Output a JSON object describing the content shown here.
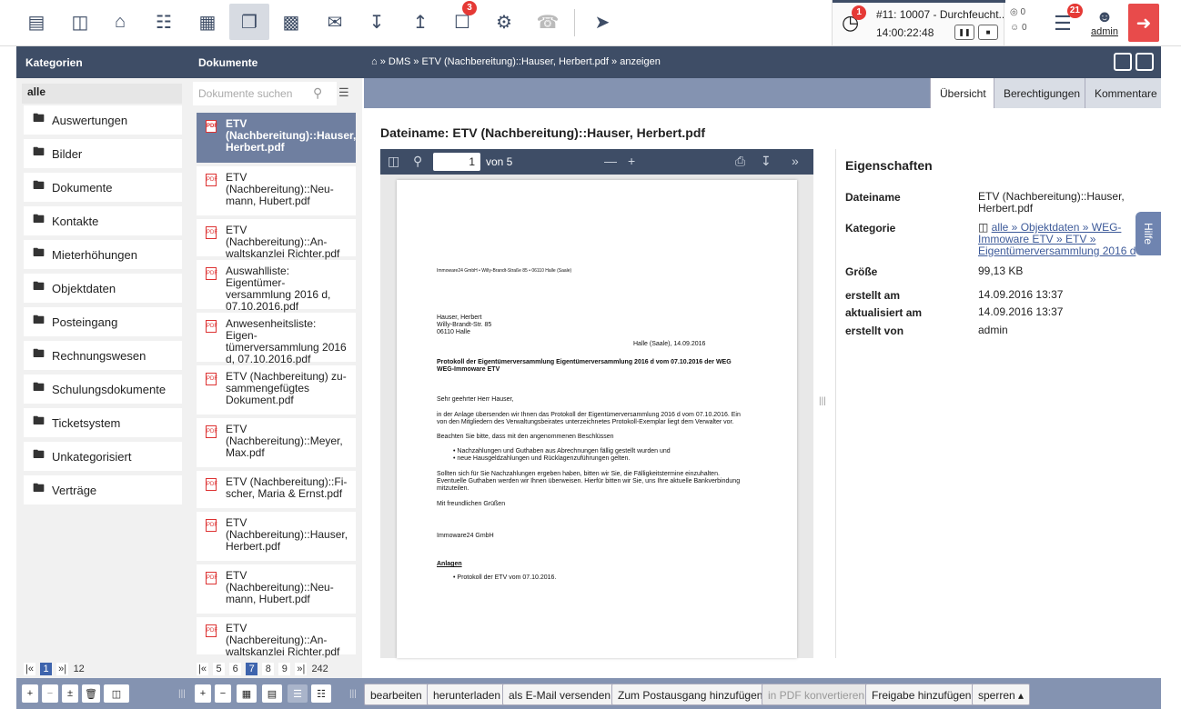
{
  "toolbar": {
    "dms_badge": "3",
    "timer": {
      "badge": "1",
      "task": "#11: 10007 - Durchfeucht...",
      "time": "14:00:22:48"
    },
    "counts": [
      "0",
      "0"
    ],
    "messages_badge": "21",
    "user": "admin"
  },
  "headers": {
    "categories": "Kategorien",
    "documents": "Dokumente",
    "breadcrumb": "⌂  »  DMS  »  ETV (Nachbereitung)::Hauser, Herbert.pdf  » anzeigen"
  },
  "categories": {
    "all": "alle",
    "items": [
      "Auswertungen",
      "Bilder",
      "Dokumente",
      "Kontakte",
      "Mieterhöhungen",
      "Objektdaten",
      "Posteingang",
      "Rechnungswesen",
      "Schulungsdokumente",
      "Ticketsystem",
      "Unkategorisiert",
      "Verträge"
    ]
  },
  "documents": {
    "search_placeholder": "Dokumente suchen",
    "items": [
      "ETV (Nachbereitung)::Hauser, Herbert.pdf",
      "ETV (Nachbereitung)::Neu-mann, Hubert.pdf",
      "ETV (Nachbereitung)::An-waltskanzlei Richter.pdf",
      "Auswahlliste: Eigentümer-versammlung 2016 d, 07.10.2016.pdf",
      "Anwesenheitsliste: Eigen-tümerversammlung 2016 d, 07.10.2016.pdf",
      "ETV (Nachbereitung) zu-sammengefügtes Dokument.pdf",
      "ETV (Nachbereitung)::Meyer, Max.pdf",
      "ETV (Nachbereitung)::Fi-scher, Maria & Ernst.pdf",
      "ETV (Nachbereitung)::Hauser, Herbert.pdf",
      "ETV (Nachbereitung)::Neu-mann, Hubert.pdf",
      "ETV (Nachbereitung)::An-waltskanzlei Richter.pdf"
    ]
  },
  "tabs": [
    "Übersicht",
    "Berechtigungen",
    "Kommentare"
  ],
  "file_title": "Dateiname: ETV (Nachbereitung)::Hauser, Herbert.pdf",
  "viewer": {
    "page": "1",
    "of": "von 5",
    "lines": [
      "Immoware24 GmbH • Willy-Brandt-Straße 85 • 06110 Halle (Saale)",
      "Hauser, Herbert",
      "Willy-Brandt-Str. 85",
      "06110 Halle",
      "Halle (Saale), 14.09.2016",
      "Protokoll der Eigentümerversammlung Eigentümerversammlung 2016 d vom 07.10.2016 der WEG",
      "WEG-Immoware ETV",
      "Sehr geehrter Herr Hauser,",
      "in der Anlage übersenden wir Ihnen das Protokoll der Eigentümerversammlung 2016 d vom 07.10.2016. Ein",
      "von den Mitgliedern des Verwaltungsbeirates unterzeichnetes Protokoll-Exemplar liegt dem Verwalter vor.",
      "Beachten Sie bitte, dass mit den angenommenen Beschlüssen",
      "•   Nachzahlungen und Guthaben aus Abrechnungen fällig gestellt wurden und",
      "•   neue Hausgeldzahlungen und Rücklagenzuführungen gelten.",
      "Sollten sich für Sie Nachzahlungen ergeben haben, bitten wir Sie, die Fälligkeitstermine einzuhalten.",
      "Eventuelle Guthaben werden wir Ihnen überweisen. Hierfür bitten wir Sie, uns Ihre aktuelle Bankverbindung",
      "mitzuteilen.",
      "Mit freundlichen Grüßen",
      "Immoware24 GmbH",
      "Anlagen",
      "•   Protokoll der ETV vom 07.10.2016."
    ]
  },
  "properties": {
    "title": "Eigenschaften",
    "rows": [
      {
        "key": "Dateiname",
        "value": "ETV (Nachbereitung)::Hauser, Herbert.pdf"
      },
      {
        "key": "Kategorie",
        "value": "alle » Objektdaten » WEG-Immoware ETV » ETV » Eigentümerversammlung 2016 d"
      },
      {
        "key": "Größe",
        "value": "99,13 KB"
      },
      {
        "key": "erstellt am",
        "value": "14.09.2016 13:37"
      },
      {
        "key": "aktualisiert am",
        "value": "14.09.2016 13:37"
      },
      {
        "key": "erstellt von",
        "value": "admin"
      }
    ]
  },
  "help": "Hilfe",
  "pager_cat": {
    "first": "|«",
    "page": "1",
    "last": "»|",
    "total": "12"
  },
  "pager_doc": {
    "first": "|«",
    "pages": [
      "5",
      "6",
      "7",
      "8",
      "9"
    ],
    "active": "7",
    "last": "»|",
    "total": "242"
  },
  "actions": [
    "bearbeiten",
    "herunterladen",
    "als E-Mail versenden",
    "Zum Postausgang hinzufügen",
    "in PDF konvertieren",
    "Freigabe hinzufügen",
    "sperren ▴"
  ],
  "bottom_buttons": [
    "+",
    "−",
    "±",
    "+",
    "−"
  ],
  "colors": {
    "accent": "#3e4d66",
    "selected": "#6f7fa0",
    "logout": "#e84b4b",
    "badge": "#e53935"
  }
}
